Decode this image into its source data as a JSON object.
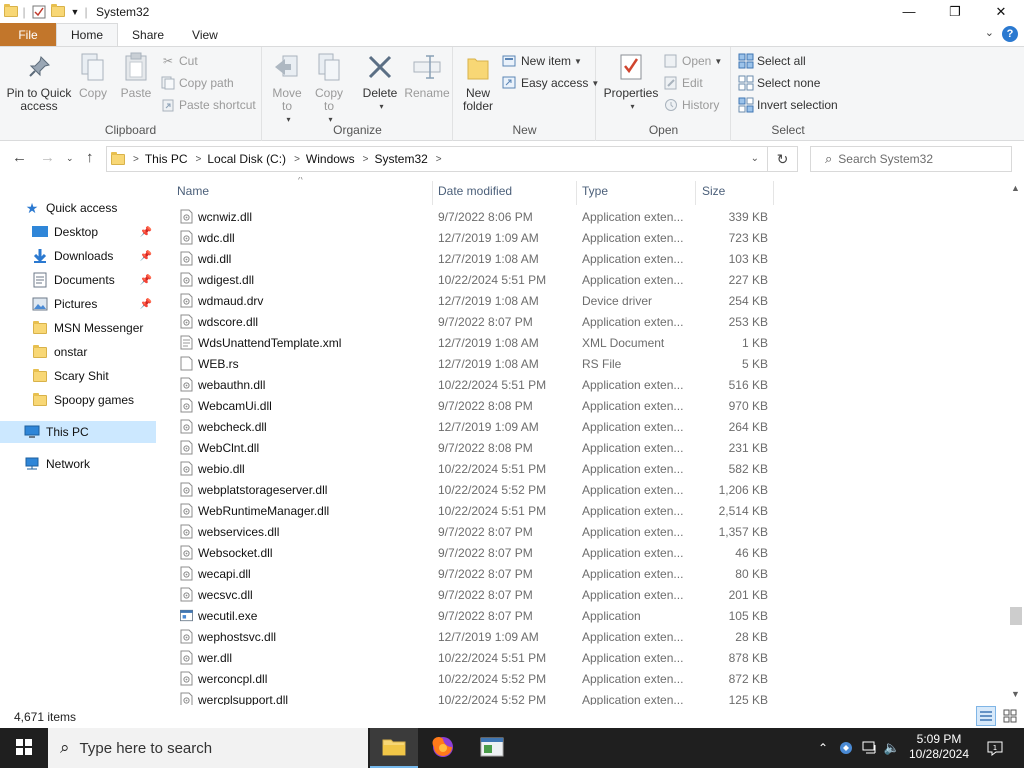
{
  "window": {
    "title": "System32",
    "minimize": "—",
    "maximize": "❐",
    "close": "✕"
  },
  "tabs": {
    "file": "File",
    "items": [
      "Home",
      "Share",
      "View"
    ],
    "active": "Home"
  },
  "ribbon": {
    "clipboard": {
      "label": "Clipboard",
      "pin": "Pin to Quick access",
      "copy": "Copy",
      "paste": "Paste",
      "cut": "Cut",
      "copy_path": "Copy path",
      "paste_shortcut": "Paste shortcut"
    },
    "organize": {
      "label": "Organize",
      "move_to": "Move to",
      "copy_to": "Copy to",
      "delete": "Delete",
      "rename": "Rename"
    },
    "new": {
      "label": "New",
      "new_folder": "New folder",
      "new_item": "New item",
      "easy_access": "Easy access"
    },
    "open": {
      "label": "Open",
      "properties": "Properties",
      "open": "Open",
      "edit": "Edit",
      "history": "History"
    },
    "select": {
      "label": "Select",
      "select_all": "Select all",
      "select_none": "Select none",
      "invert": "Invert selection"
    }
  },
  "address": {
    "crumbs": [
      "This PC",
      "Local Disk (C:)",
      "Windows",
      "System32"
    ],
    "search_placeholder": "Search System32"
  },
  "navpane": {
    "quick_access": "Quick access",
    "pinned": [
      {
        "label": "Desktop",
        "icon": "desktop-icon"
      },
      {
        "label": "Downloads",
        "icon": "downloads-icon"
      },
      {
        "label": "Documents",
        "icon": "documents-icon"
      },
      {
        "label": "Pictures",
        "icon": "pictures-icon"
      }
    ],
    "folders": [
      "MSN Messenger",
      "onstar",
      "Scary Shit",
      "Spoopy games"
    ],
    "this_pc": "This PC",
    "network": "Network"
  },
  "columns": {
    "name": "Name",
    "date": "Date modified",
    "type": "Type",
    "size": "Size"
  },
  "files": [
    {
      "name": "wcnwiz.dll",
      "date": "9/7/2022 8:06 PM",
      "type": "Application exten...",
      "size": "339 KB",
      "icon": "dll"
    },
    {
      "name": "wdc.dll",
      "date": "12/7/2019 1:09 AM",
      "type": "Application exten...",
      "size": "723 KB",
      "icon": "dll"
    },
    {
      "name": "wdi.dll",
      "date": "12/7/2019 1:08 AM",
      "type": "Application exten...",
      "size": "103 KB",
      "icon": "dll"
    },
    {
      "name": "wdigest.dll",
      "date": "10/22/2024 5:51 PM",
      "type": "Application exten...",
      "size": "227 KB",
      "icon": "dll"
    },
    {
      "name": "wdmaud.drv",
      "date": "12/7/2019 1:08 AM",
      "type": "Device driver",
      "size": "254 KB",
      "icon": "dll"
    },
    {
      "name": "wdscore.dll",
      "date": "9/7/2022 8:07 PM",
      "type": "Application exten...",
      "size": "253 KB",
      "icon": "dll"
    },
    {
      "name": "WdsUnattendTemplate.xml",
      "date": "12/7/2019 1:08 AM",
      "type": "XML Document",
      "size": "1 KB",
      "icon": "xml"
    },
    {
      "name": "WEB.rs",
      "date": "12/7/2019 1:08 AM",
      "type": "RS File",
      "size": "5 KB",
      "icon": "blank"
    },
    {
      "name": "webauthn.dll",
      "date": "10/22/2024 5:51 PM",
      "type": "Application exten...",
      "size": "516 KB",
      "icon": "dll"
    },
    {
      "name": "WebcamUi.dll",
      "date": "9/7/2022 8:08 PM",
      "type": "Application exten...",
      "size": "970 KB",
      "icon": "dll"
    },
    {
      "name": "webcheck.dll",
      "date": "12/7/2019 1:09 AM",
      "type": "Application exten...",
      "size": "264 KB",
      "icon": "dll"
    },
    {
      "name": "WebClnt.dll",
      "date": "9/7/2022 8:08 PM",
      "type": "Application exten...",
      "size": "231 KB",
      "icon": "dll"
    },
    {
      "name": "webio.dll",
      "date": "10/22/2024 5:51 PM",
      "type": "Application exten...",
      "size": "582 KB",
      "icon": "dll"
    },
    {
      "name": "webplatstorageserver.dll",
      "date": "10/22/2024 5:52 PM",
      "type": "Application exten...",
      "size": "1,206 KB",
      "icon": "dll"
    },
    {
      "name": "WebRuntimeManager.dll",
      "date": "10/22/2024 5:51 PM",
      "type": "Application exten...",
      "size": "2,514 KB",
      "icon": "dll"
    },
    {
      "name": "webservices.dll",
      "date": "9/7/2022 8:07 PM",
      "type": "Application exten...",
      "size": "1,357 KB",
      "icon": "dll"
    },
    {
      "name": "Websocket.dll",
      "date": "9/7/2022 8:07 PM",
      "type": "Application exten...",
      "size": "46 KB",
      "icon": "dll"
    },
    {
      "name": "wecapi.dll",
      "date": "9/7/2022 8:07 PM",
      "type": "Application exten...",
      "size": "80 KB",
      "icon": "dll"
    },
    {
      "name": "wecsvc.dll",
      "date": "9/7/2022 8:07 PM",
      "type": "Application exten...",
      "size": "201 KB",
      "icon": "dll"
    },
    {
      "name": "wecutil.exe",
      "date": "9/7/2022 8:07 PM",
      "type": "Application",
      "size": "105 KB",
      "icon": "exe"
    },
    {
      "name": "wephostsvc.dll",
      "date": "12/7/2019 1:09 AM",
      "type": "Application exten...",
      "size": "28 KB",
      "icon": "dll"
    },
    {
      "name": "wer.dll",
      "date": "10/22/2024 5:51 PM",
      "type": "Application exten...",
      "size": "878 KB",
      "icon": "dll"
    },
    {
      "name": "werconcpl.dll",
      "date": "10/22/2024 5:52 PM",
      "type": "Application exten...",
      "size": "872 KB",
      "icon": "dll"
    },
    {
      "name": "wercplsupport.dll",
      "date": "10/22/2024 5:52 PM",
      "type": "Application exten...",
      "size": "125 KB",
      "icon": "dll"
    }
  ],
  "status": {
    "count": "4,671 items"
  },
  "taskbar": {
    "search_placeholder": "Type here to search",
    "time": "5:09 PM",
    "date": "10/28/2024"
  }
}
